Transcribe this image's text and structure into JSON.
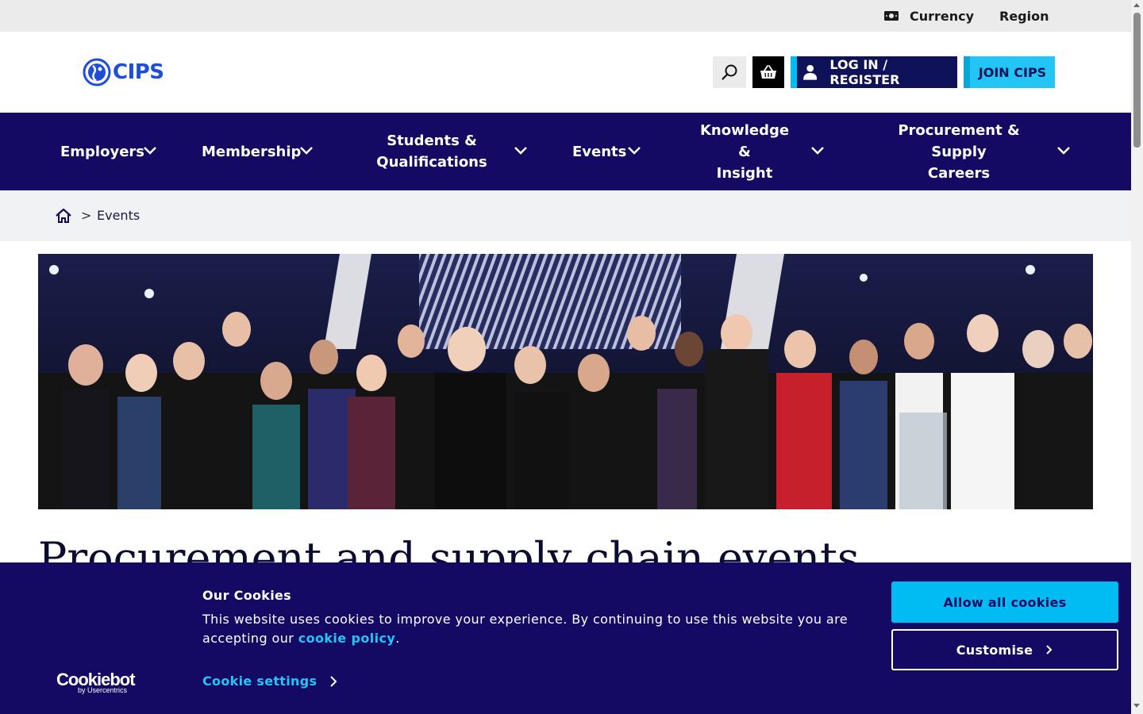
{
  "utility": {
    "currency_label": "Currency",
    "region_label": "Region"
  },
  "header": {
    "logo_text": "CIPS",
    "login_label": "LOG IN / REGISTER",
    "join_label": "JOIN CIPS"
  },
  "nav": {
    "items": [
      {
        "line1": "Employers",
        "line2": ""
      },
      {
        "line1": "Membership",
        "line2": ""
      },
      {
        "line1": "Students &",
        "line2": "Qualifications"
      },
      {
        "line1": "Events",
        "line2": ""
      },
      {
        "line1": "Knowledge &",
        "line2": "Insight"
      },
      {
        "line1": "Procurement & Supply",
        "line2": "Careers"
      }
    ]
  },
  "breadcrumb": {
    "separator": ">",
    "current": "Events"
  },
  "hero": {
    "image_alt": ""
  },
  "page": {
    "title": "Procurement and supply chain events"
  },
  "cookie": {
    "title": "Our Cookies",
    "text_before": "This website uses cookies to improve your experience. By continuing to use this website you are accepting our ",
    "link_text": "cookie policy",
    "text_after": ".",
    "settings_label": "Cookie settings",
    "allow_label": "Allow all cookies",
    "customise_label": "Customise",
    "brand_main": "Cookiebot",
    "brand_sub": "by Usercentrics"
  },
  "colors": {
    "navy": "#140a64",
    "cyan": "#00bcf2",
    "logo_blue": "#1d4ed8"
  }
}
